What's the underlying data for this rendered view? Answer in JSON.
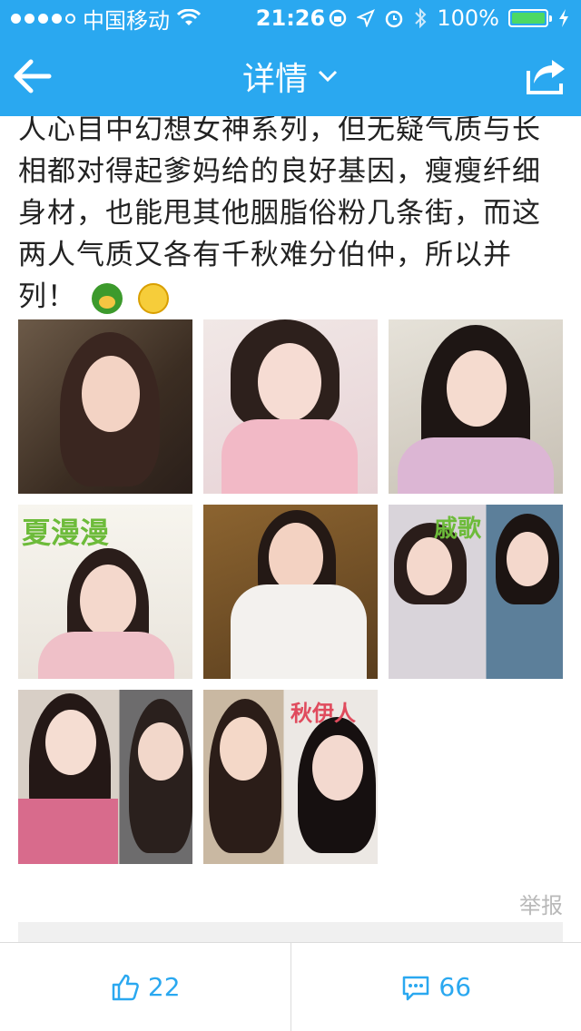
{
  "status_bar": {
    "carrier": "中国移动",
    "time": "21:26",
    "battery": "100%",
    "signal_strength": 0.8
  },
  "nav": {
    "title": "详情",
    "back_icon": "arrow-left-icon",
    "share_icon": "share-icon",
    "dropdown_icon": "chevron-down-icon"
  },
  "post": {
    "text": "人心目中幻想女神系列，但无疑气质与长相都对得起爹妈给的良好基因，瘦瘦纤细身材，也能甩其他胭脂俗粉几条街，而这两人气质又各有千秋难分伯仲，所以并列！",
    "images": [
      {
        "caption": ""
      },
      {
        "caption": ""
      },
      {
        "caption": ""
      },
      {
        "caption": "夏漫漫"
      },
      {
        "caption": ""
      },
      {
        "caption": "戚歌"
      },
      {
        "caption": ""
      },
      {
        "caption": "秋伊人"
      }
    ],
    "report_label": "举报"
  },
  "bottom": {
    "like_count": "22",
    "comment_count": "66"
  },
  "colors": {
    "primary": "#2aa8f0",
    "battery": "#4cd964"
  }
}
